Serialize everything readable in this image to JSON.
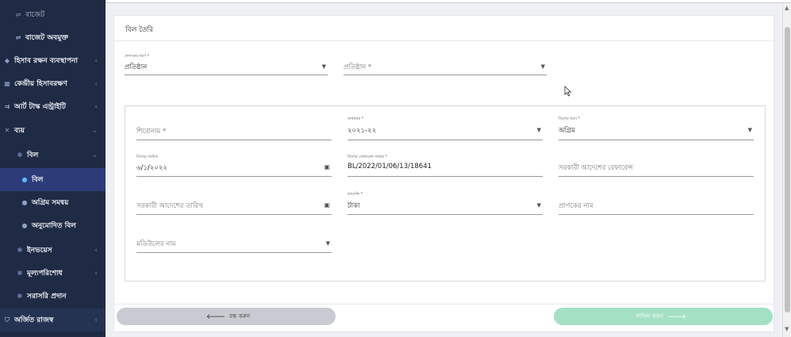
{
  "sidebar": {
    "items": [
      {
        "icon": "link-icon",
        "label": "বাজেট"
      },
      {
        "icon": "link-icon",
        "label": "বাজেট অবমুক্ত"
      },
      {
        "icon": "accounts-icon",
        "label": "হিসাব রক্ষন ব্যবস্থাপনা"
      },
      {
        "icon": "grid-icon",
        "label": "কেন্দ্রীয় হিসাবরক্ষণ"
      },
      {
        "icon": "arrow-icon",
        "label": "আর্ট টাস্ক এন্ট্রাইটি"
      },
      {
        "icon": "expense-icon",
        "label": "ব্যয়"
      },
      {
        "icon": "gear-icon",
        "label": "বিল"
      },
      {
        "icon": "check-circle-icon",
        "label": "বিল"
      },
      {
        "icon": "check-circle-icon",
        "label": "অগ্রিম সমন্বয়"
      },
      {
        "icon": "check-circle-icon",
        "label": "অনুমোদিত বিল"
      },
      {
        "icon": "gear-icon",
        "label": "ইনভয়েস"
      },
      {
        "icon": "gear-icon",
        "label": "মূল্যপরিশোধ"
      },
      {
        "icon": "gear-icon",
        "label": "সরাসরি প্রদান"
      },
      {
        "icon": "shield-icon",
        "label": "অর্জিত রাজস্ব"
      }
    ],
    "chevron": "‹",
    "chevron_open": "⌄"
  },
  "card": {
    "title": "বিল তৈরি"
  },
  "form": {
    "recipient_type": {
      "label": "প্রাপকের ধরণ *",
      "value": "প্রতিষ্ঠান"
    },
    "organization": {
      "placeholder": "প্রতিষ্ঠান *"
    },
    "heading": {
      "placeholder": "শিরোনাম *"
    },
    "fiscal_year": {
      "label": "অর্থবছর *",
      "value": "২০২১-২২"
    },
    "bill_type": {
      "label": "বিলের ধরণ *",
      "value": "অগ্রিম"
    },
    "bill_date": {
      "label": "বিলের তারিখ",
      "value": "৬/১/২০২২"
    },
    "bill_reference": {
      "label": "বিলের রেফারেন্স নাম্বার *",
      "value": "BL/2022/01/06/13/18641"
    },
    "gov_order_ref": {
      "placeholder": "সরকারী আদেশের রেফারেন্স"
    },
    "gov_order_date": {
      "placeholder": "সরকারী আদেশের তারিখ"
    },
    "currency": {
      "label": "কারেন্সি *",
      "value": "টাকা"
    },
    "recipient_name": {
      "placeholder": "প্রাপকের নাম"
    },
    "model_name": {
      "placeholder": "মডিউলের নাম"
    }
  },
  "actions": {
    "close_label": "বন্ধ করুন",
    "submit_label": "দাখিল করুন"
  },
  "colors": {
    "sidebar_bg": "#1f2a44",
    "sidebar_active": "#2d3b79",
    "submit_bg": "#a4e1c4",
    "close_bg": "#c8cbd1"
  }
}
